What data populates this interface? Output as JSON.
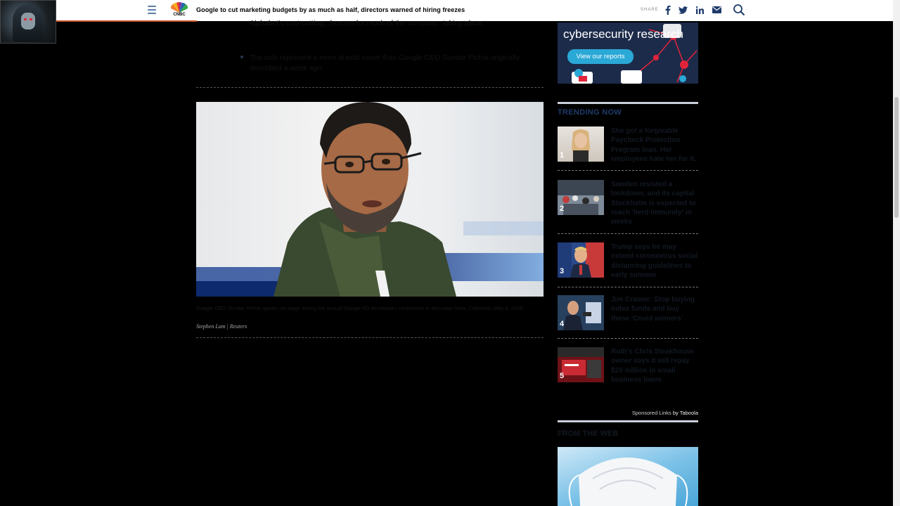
{
  "header": {
    "logo_text": "CNBC",
    "headline": "Google to cut marketing budgets by as much as half, directors warned of hiring freezes",
    "share_label": "SHARE",
    "share_icons": [
      "facebook-icon",
      "twitter-icon",
      "linkedin-icon",
      "email-icon"
    ],
    "accent_color": "#c8552c"
  },
  "article": {
    "bullets": [
      "Alphabet's cost-cutting...freezes for much of the company...taking place.",
      "The cuts represent a more drastic move than Google CEO Sundar Pichai originally described a week ago."
    ],
    "caption": "Google CEO Sundar Pichai speaks on stage during the annual Google I/O developers conference in Mountain View, California, May 8, 2018.",
    "credit": "Stephen Lam | Reuters"
  },
  "sidebar": {
    "ad": {
      "title": "cybersecurity research",
      "button": "View our reports"
    },
    "trending_title": "TRENDING NOW",
    "trending": [
      {
        "num": "1",
        "text": "She got a forgivable Paycheck Protection Program loan. Her employees hate her for it."
      },
      {
        "num": "2",
        "text": "Sweden resisted a lockdown, and its capital Stockholm is expected to reach 'herd immunity' in weeks"
      },
      {
        "num": "3",
        "text": "Trump says he may extend coronavirus social distancing guidelines to early summer"
      },
      {
        "num": "4",
        "text": "Jim Cramer: Stop buying index funds and buy these 'Covid winners'"
      },
      {
        "num": "5",
        "text": "Ruth's Chris Steakhouse owner says it will repay $20 million in small business loans"
      }
    ],
    "sponsored_prefix": "Sponsored Links",
    "sponsored_by": "by Taboola",
    "from_web_title": "FROM THE WEB"
  }
}
